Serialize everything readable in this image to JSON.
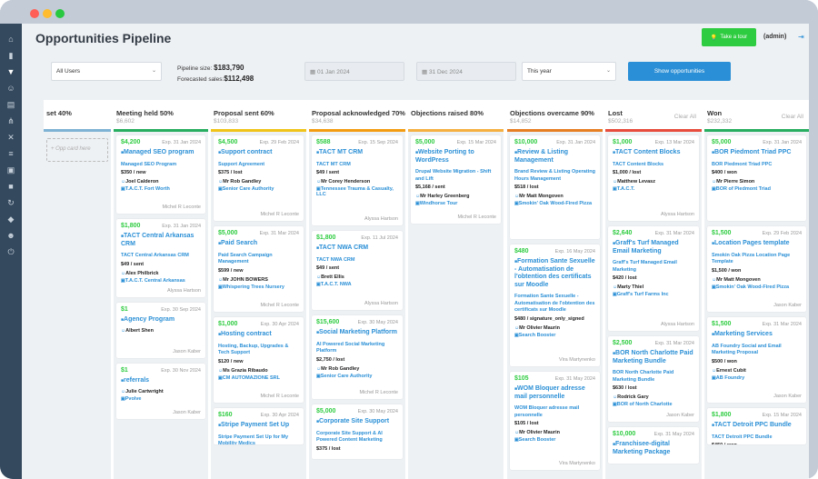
{
  "window": {
    "dots": [
      "#ff5f57",
      "#febc2e",
      "#28c840"
    ]
  },
  "page": {
    "title": "Opportunities Pipeline",
    "tour_label": "Take a tour",
    "user": "(admin)"
  },
  "filters": {
    "users": "All Users",
    "pipeline_size_label": "Pipeline size:",
    "pipeline_size": "$183,790",
    "forecasted_label": "Forecasted sales:",
    "forecasted": "$112,498",
    "date_from": "01 Jan 2024",
    "date_to": "31 Dec 2024",
    "period": "This year",
    "show_button": "Show opportunities"
  },
  "sidebar": {
    "icons": [
      "home-icon",
      "chart-icon",
      "filter-icon",
      "users-icon",
      "org-icon",
      "flow-icon",
      "tools-icon",
      "list-icon",
      "id-card-icon",
      "box-icon",
      "refresh-icon",
      "tag-icon",
      "user-settings-icon",
      "power-icon"
    ]
  },
  "columns": [
    {
      "name": "set 40%",
      "total": "",
      "color": "#7fb3d5",
      "clear": "",
      "add": "+ Opp card here",
      "cards": []
    },
    {
      "name": "Meeting held 50%",
      "total": "$6,602",
      "color": "#27ae60",
      "clear": "",
      "cards": [
        {
          "amt": "$4,200",
          "exp": "Exp. 31 Jan 2024",
          "title": "Managed SEO program",
          "l1": "Managed SEO Program",
          "l2": "$350 / new",
          "p": "Joel Calderon",
          "c": "T.A.C.T. Fort Worth",
          "own": "Michel R Leconte"
        },
        {
          "amt": "$1,800",
          "exp": "Exp. 31 Jan 2024",
          "title": "TACT Central Arkansas CRM",
          "l1": "TACT Central Arkansas CRM",
          "l2": "$49 / sent",
          "p": "Alex Philbrick",
          "c": "T.A.C.T. Central Arkansas",
          "own": "Alyssa Hartson"
        },
        {
          "amt": "$1",
          "exp": "Exp. 30 Sep 2024",
          "title": "Agency Program",
          "l1": "",
          "l2": "",
          "p": "Albert Shen",
          "c": "",
          "own": "Jason Kaber"
        },
        {
          "amt": "$1",
          "exp": "Exp. 30 Nov 2024",
          "title": "referrals",
          "l1": "",
          "l2": "",
          "p": "Julie Cartwright",
          "c": "Pvolve",
          "own": "Jason Kaber"
        }
      ]
    },
    {
      "name": "Proposal sent 60%",
      "total": "$103,833",
      "color": "#f0c419",
      "clear": "",
      "cards": [
        {
          "amt": "$4,500",
          "exp": "Exp. 29 Feb 2024",
          "title": "Support contract",
          "l1": "Support Agreement",
          "l2": "$375 / lost",
          "p": "Mr Rob Gandley",
          "c": "Senior Care Authority",
          "own": "Michel R Leconte"
        },
        {
          "amt": "$5,000",
          "exp": "Exp. 31 Mar 2024",
          "title": "Paid Search",
          "l1": "Paid Search Campaign Management",
          "l2": "$599 / new",
          "p": "Mr JOHN BOWERS",
          "c": "Whispering Trees Nursery",
          "own": "Michel R Leconte"
        },
        {
          "amt": "$1,000",
          "exp": "Exp. 30 Apr 2024",
          "title": "Hosting contract",
          "l1": "Hosting, Backup, Upgrades & Tech Support",
          "l2": "$120 / new",
          "p": "Ms Grazia Ribaudo",
          "c": "CM AUTOMAZIONE SRL",
          "own": "Michel R Leconte"
        },
        {
          "amt": "$160",
          "exp": "Exp. 30 Apr 2024",
          "title": "Stripe Payment Set Up",
          "l1": "Stripe Payment Set Up for My Mobility Medics",
          "l2": "",
          "p": "",
          "c": "",
          "own": ""
        }
      ]
    },
    {
      "name": "Proposal acknowledged 70%",
      "total": "$34,638",
      "color": "#f39c12",
      "clear": "",
      "cards": [
        {
          "amt": "$588",
          "exp": "Exp. 15 Sep 2024",
          "title": "TACT MT CRM",
          "l1": "TACT MT CRM",
          "l2": "$49 / sent",
          "p": "Mr Corey Henderson",
          "c": "Tennessee Trauma & Casualty, LLC",
          "own": "Alyssa Hartson"
        },
        {
          "amt": "$1,800",
          "exp": "Exp. 11 Jul 2024",
          "title": "TACT NWA CRM",
          "l1": "TACT NWA CRM",
          "l2": "$49 / sent",
          "p": "Brett Ellis",
          "c": "T.A.C.T. NWA",
          "own": "Alyssa Hartson"
        },
        {
          "amt": "$15,600",
          "exp": "Exp. 30 May 2024",
          "title": "Social Marketing Platform",
          "l1": "AI Powered Social Marketing Platform",
          "l2": "$2,750 / lost",
          "p": "Mr Rob Gandley",
          "c": "Senior Care Authority",
          "own": "Michel R Leconte"
        },
        {
          "amt": "$5,000",
          "exp": "Exp. 30 May 2024",
          "title": "Corporate Site Support",
          "l1": "Corporate Site Support & AI Powered Content Marketing",
          "l2": "$375 / lost",
          "p": "",
          "c": "",
          "own": ""
        }
      ]
    },
    {
      "name": "Objections raised 80%",
      "total": "",
      "color": "#f5b041",
      "clear": "",
      "cards": [
        {
          "amt": "$5,000",
          "exp": "Exp. 15 Mar 2024",
          "title": "Website Porting to WordPress",
          "l1": "Drupal Website Migration - Shift and Lift",
          "l2": "$5,168 / sent",
          "p": "Mr Harley Greenberg",
          "c": "Windhorse Tour",
          "own": "Michel R Leconte"
        }
      ]
    },
    {
      "name": "Objections overcame 90%",
      "total": "$14,852",
      "color": "#e67e22",
      "clear": "",
      "cards": [
        {
          "amt": "$10,000",
          "exp": "Exp. 31 Jan 2024",
          "title": "Review & Listing Management",
          "l1": "Brand Review & Listing Operating Hours Management",
          "l2": "$518 / lost",
          "p": "Mr Matt Mongoven",
          "c": "Smokin' Oak Wood-Fired Pizza",
          "own": ""
        },
        {
          "amt": "$480",
          "exp": "Exp. 16 May 2024",
          "title": "Formation Sante Sexuelle - Automatisation de l'obtention des certificats sur Moodle",
          "l1": "Formation Sante Sexuelle - Automatisation de l'obtention des certificats sur Moodle",
          "l2": "$480 / signature_only_signed",
          "p": "Mr Olivier Maurin",
          "c": "Search Booster",
          "own": "Vira Martynenko"
        },
        {
          "amt": "$105",
          "exp": "Exp. 31 May 2024",
          "title": "WOM Bloquer adresse mail personnelle",
          "l1": "WOM Bloquer adresse mail personnelle",
          "l2": "$105 / lost",
          "p": "Mr Olivier Maurin",
          "c": "Search Booster",
          "own": "Vira Martynenko"
        }
      ]
    },
    {
      "name": "Lost",
      "total": "$502,316",
      "color": "#e74c3c",
      "clear": "Clear All",
      "cards": [
        {
          "amt": "$1,000",
          "exp": "Exp. 13 Mar 2024",
          "title": "TACT Content Blocks",
          "l1": "TACT Content Blocks",
          "l2": "$1,000 / lost",
          "p": "Matthew Levasz",
          "c": "T.A.C.T.",
          "own": "Alyssa Hartson"
        },
        {
          "amt": "$2,640",
          "exp": "Exp. 31 Mar 2024",
          "title": "Graff's Turf Managed Email Marketing",
          "l1": "Graff's Turf Managed Email Marketing",
          "l2": "$420 / lost",
          "p": "Marty Thiel",
          "c": "Graff's Turf Farms Inc",
          "own": "Alyssa Hartson"
        },
        {
          "amt": "$2,500",
          "exp": "Exp. 31 Mar 2024",
          "title": "BOR North Charlotte Paid Marketing Bundle",
          "l1": "BOR North Charlotte Paid Marketing Bundle",
          "l2": "$630 / lost",
          "p": "Rodrick Gary",
          "c": "BOR of North Charlotte",
          "own": "Jason Kaber"
        },
        {
          "amt": "$10,000",
          "exp": "Exp. 31 May 2024",
          "title": "Franchisee-digital Marketing Package",
          "l1": "",
          "l2": "",
          "p": "",
          "c": "",
          "own": ""
        }
      ]
    },
    {
      "name": "Won",
      "total": "$232,332",
      "color": "#27ae60",
      "clear": "Clear All",
      "cards": [
        {
          "amt": "$5,000",
          "exp": "Exp. 31 Jan 2024",
          "title": "BOR Piedmont Triad PPC",
          "l1": "BOR Piedmont Triad PPC",
          "l2": "$400 / won",
          "p": "Mr Pierre Simon",
          "c": "BOR of Piedmont Triad",
          "own": ""
        },
        {
          "amt": "$1,500",
          "exp": "Exp. 29 Feb 2024",
          "title": "Location Pages template",
          "l1": "Smokin Oak Pizza Location Page Template",
          "l2": "$1,500 / won",
          "p": "Mr Matt Mongoven",
          "c": "Smokin' Oak Wood-Fired Pizza",
          "own": "Jason Kaber"
        },
        {
          "amt": "$1,500",
          "exp": "Exp. 31 Mar 2024",
          "title": "Marketing Services",
          "l1": "AB Foundry Social and Email Marketing Proposal",
          "l2": "$500 / won",
          "p": "Ernest Cubit",
          "c": "AB Foundry",
          "own": "Jason Kaber"
        },
        {
          "amt": "$1,800",
          "exp": "Exp. 15 Mar 2024",
          "title": "TACT Detroit PPC Bundle",
          "l1": "TACT Detroit PPC Bundle",
          "l2": "$450 / won",
          "p": "",
          "c": "",
          "own": ""
        }
      ]
    }
  ]
}
